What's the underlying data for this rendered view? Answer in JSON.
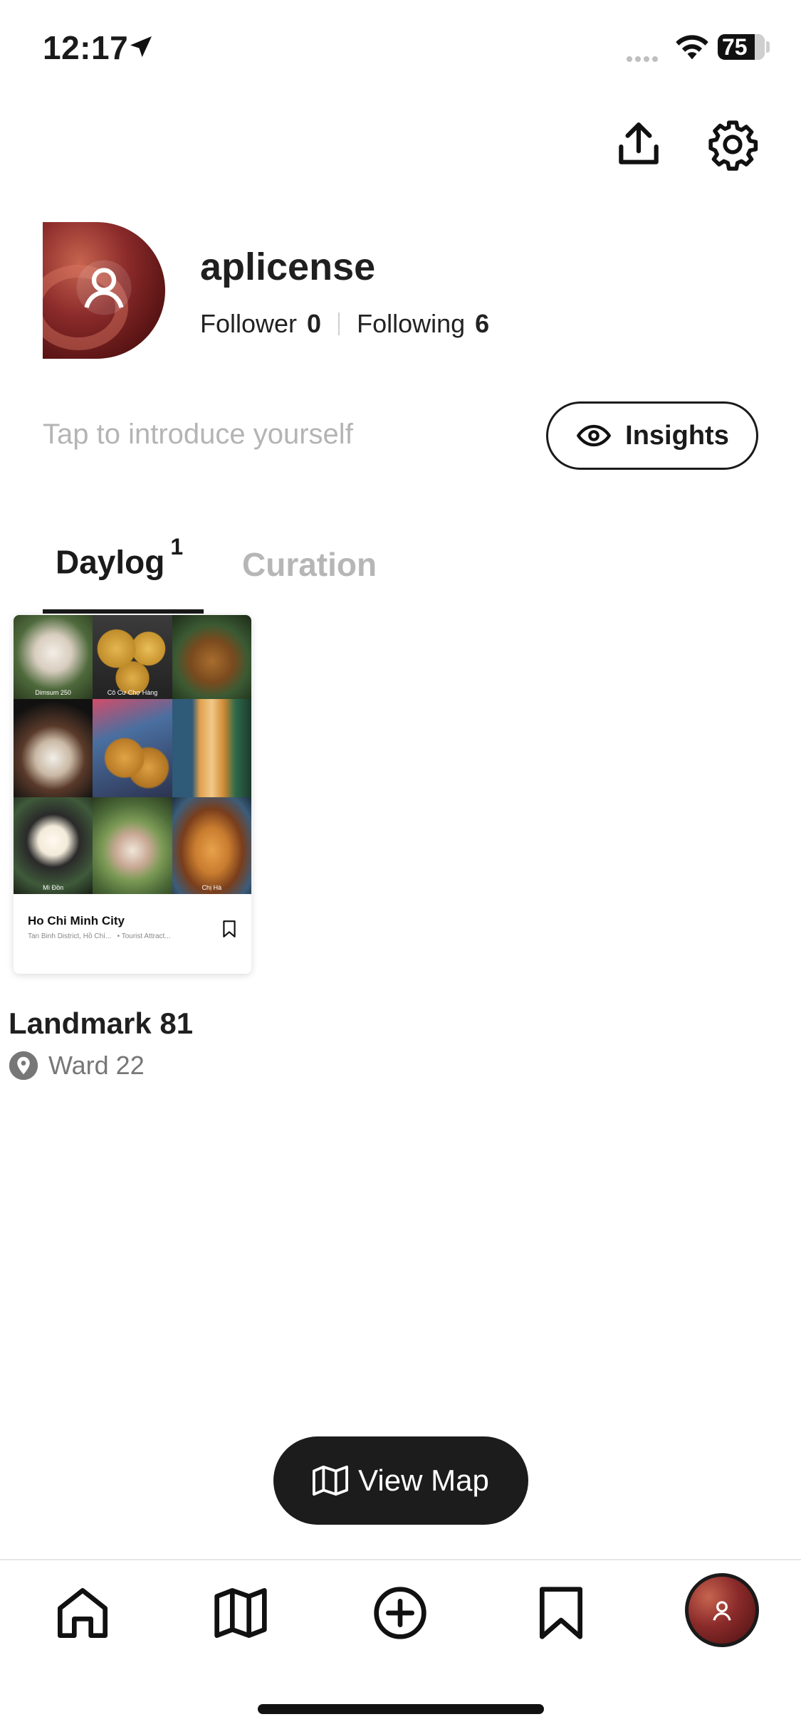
{
  "status_bar": {
    "time": "12:17",
    "battery": "75",
    "location_icon": "location-arrow-icon",
    "wifi_icon": "wifi-icon"
  },
  "header": {
    "share_icon": "share-upload-icon",
    "settings_icon": "gear-icon"
  },
  "profile": {
    "username": "aplicense",
    "follower_label": "Follower",
    "follower_count": "0",
    "following_label": "Following",
    "following_count": "6",
    "intro_placeholder": "Tap to introduce yourself",
    "insights_label": "Insights"
  },
  "tabs": [
    {
      "label": "Daylog",
      "count": "1",
      "active": true
    },
    {
      "label": "Curation",
      "active": false
    }
  ],
  "daylog_card": {
    "title": "Ho Chi Minh City",
    "subtitle_location": "Tan Binh District, Hồ Chí...",
    "subtitle_category": "• Tourist Attract...",
    "grid_captions": [
      "Dimsum 250",
      "Cô Cư Chợ Hàng",
      "",
      "",
      "",
      "",
      "Mì Đồn",
      "",
      "Chị Hà"
    ],
    "place_title": "Landmark 81",
    "place_location": "Ward 22"
  },
  "view_map_label": "View Map",
  "colors": {
    "primary": "#1a1a1a",
    "muted": "#b6b6b6",
    "avatar": "#8a2a2a"
  },
  "nav": [
    "home-icon",
    "map-icon",
    "add-circle-icon",
    "bookmark-icon",
    "profile-avatar"
  ]
}
